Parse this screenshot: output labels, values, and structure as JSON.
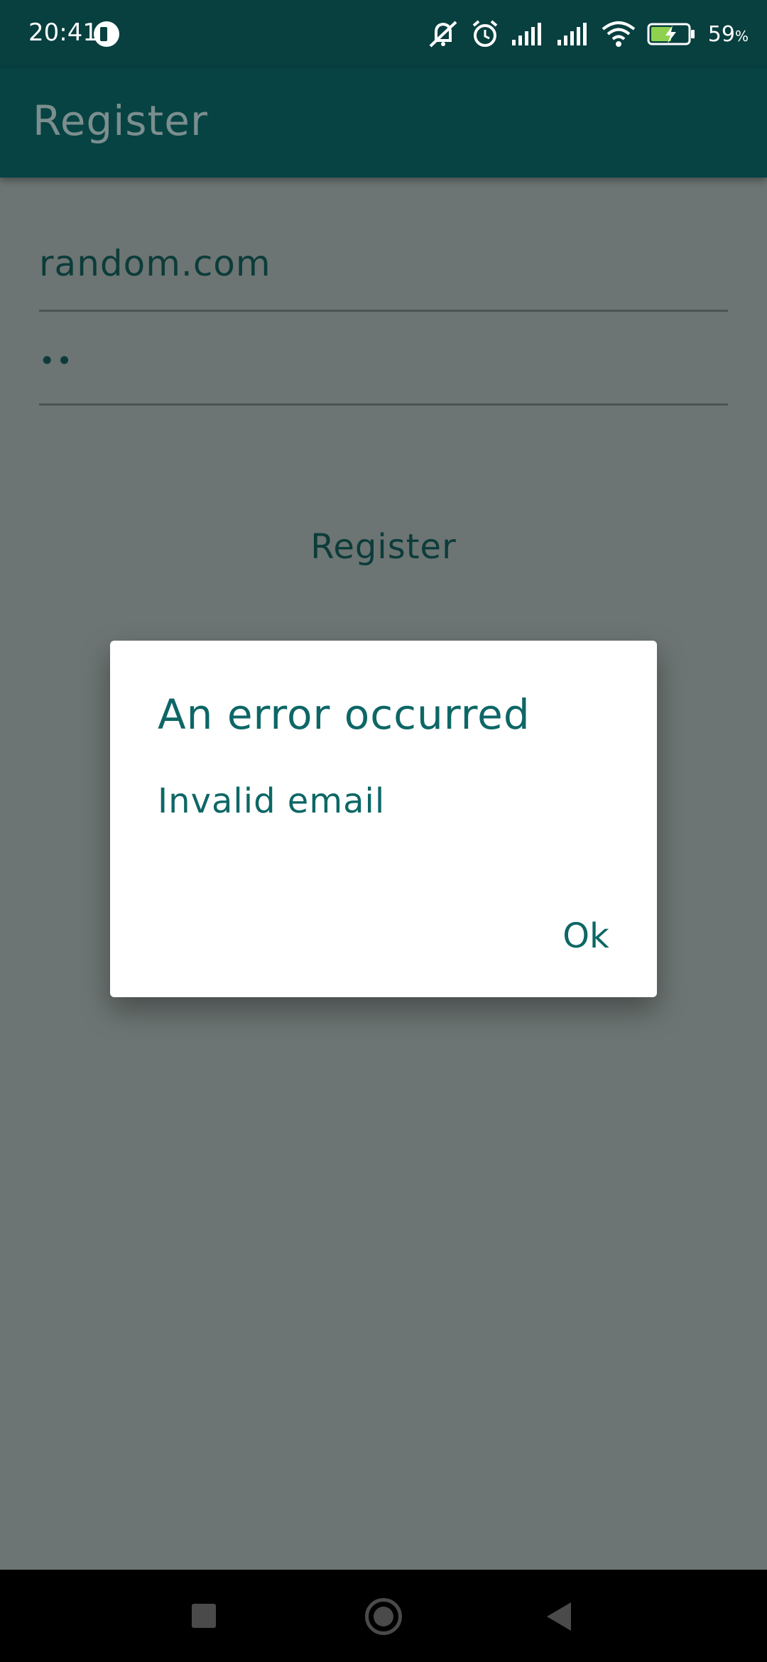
{
  "status_bar": {
    "time": "20:41",
    "battery_percent": "59",
    "battery_unit": "%",
    "icons": [
      "app-notification-icon",
      "bell-muted-icon",
      "alarm-icon",
      "signal-1-icon",
      "signal-2-icon",
      "wifi-icon",
      "battery-charging-icon"
    ]
  },
  "app_bar": {
    "title": "Register"
  },
  "form": {
    "email_value": "random.com",
    "password_value": "••",
    "register_label": "Register"
  },
  "dialog": {
    "title": "An error occurred",
    "message": "Invalid email",
    "ok_label": "Ok"
  },
  "colors": {
    "primary_dark": "#083f3f",
    "primary": "#074343",
    "accent_text": "#0d6766",
    "scrim_background": "#6c7573"
  }
}
